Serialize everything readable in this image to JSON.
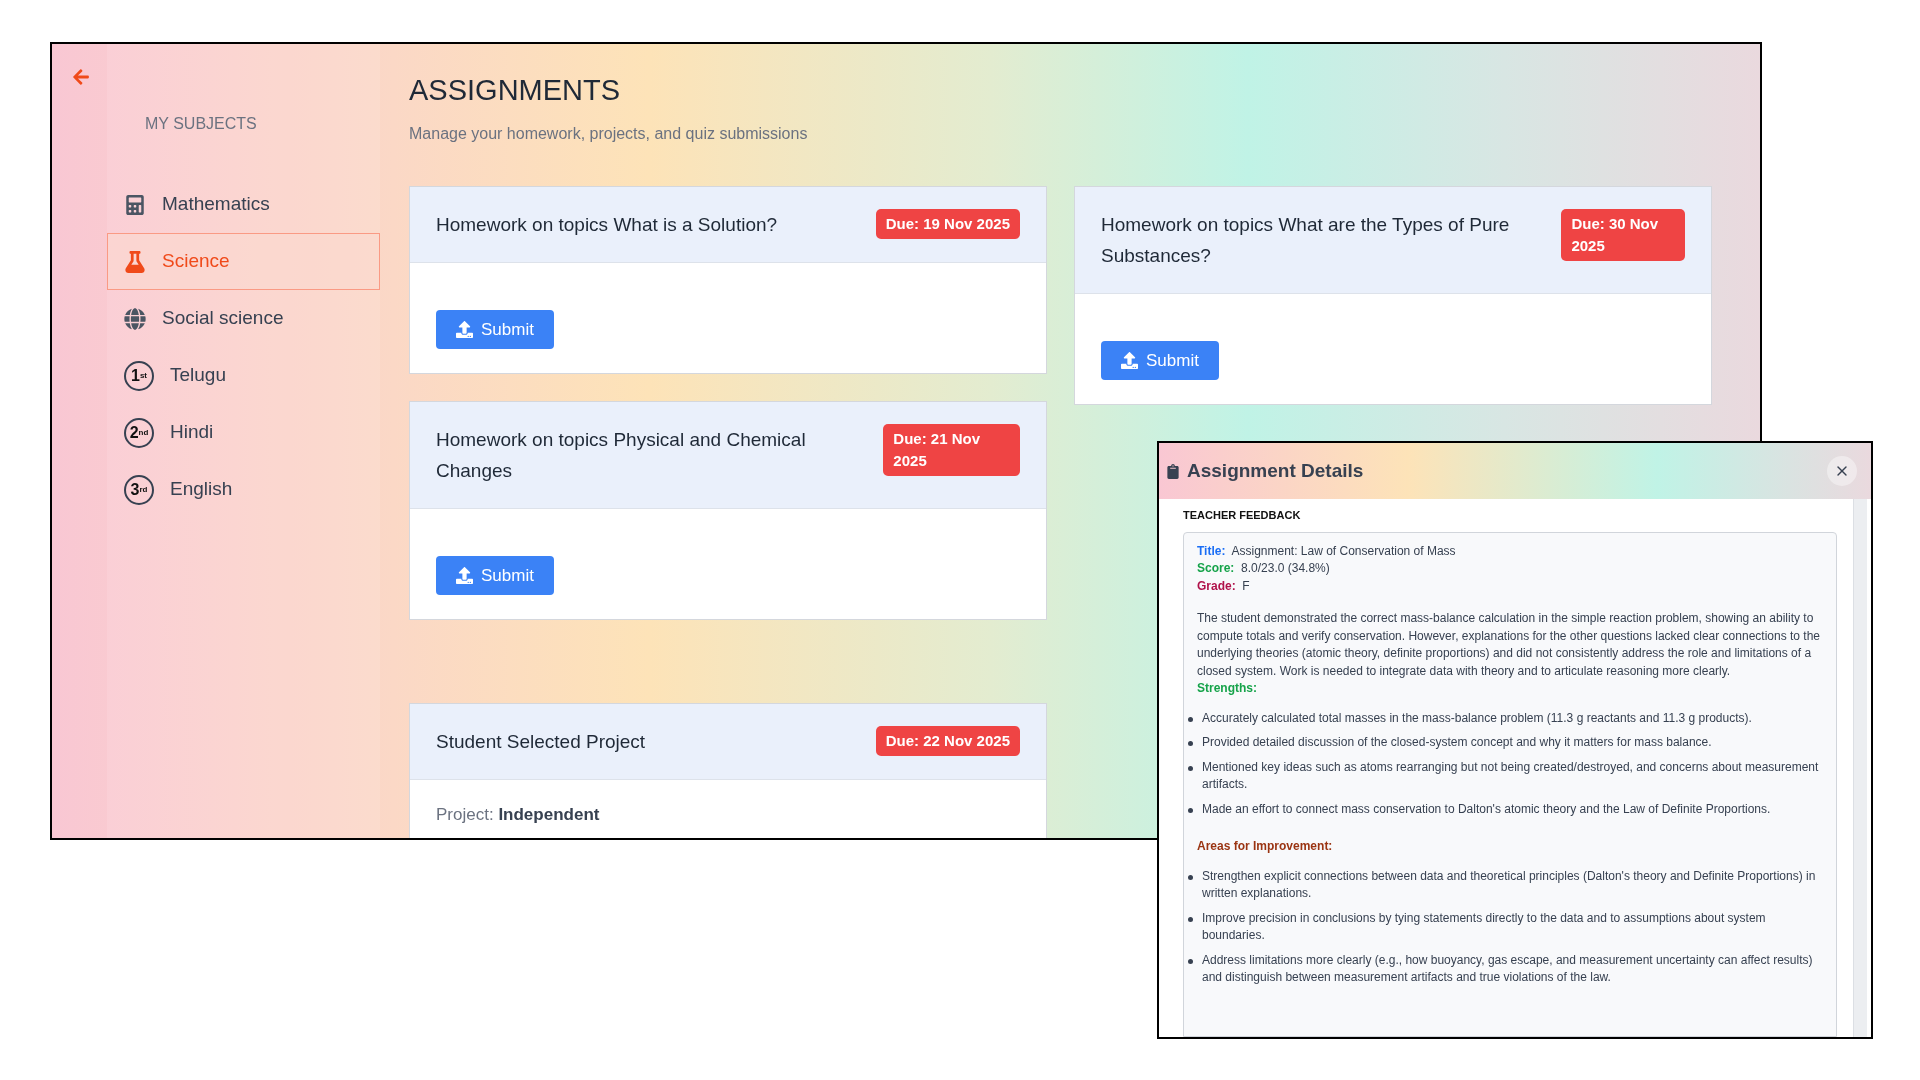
{
  "sidebar": {
    "heading": "MY SUBJECTS",
    "items": [
      {
        "kind": "calculator",
        "label": "Mathematics",
        "selected": false
      },
      {
        "kind": "flask",
        "label": "Science",
        "selected": true
      },
      {
        "kind": "globe",
        "label": "Social science",
        "selected": false
      },
      {
        "kind": "ordinal",
        "number": "1",
        "suffix": "st",
        "label": "Telugu",
        "selected": false
      },
      {
        "kind": "ordinal",
        "number": "2",
        "suffix": "nd",
        "label": "Hindi",
        "selected": false
      },
      {
        "kind": "ordinal",
        "number": "3",
        "suffix": "rd",
        "label": "English",
        "selected": false
      }
    ]
  },
  "main": {
    "title": "ASSIGNMENTS",
    "subtitle": "Manage your homework, projects, and quiz submissions",
    "columns": [
      [
        {
          "kind": "submit",
          "title": "Homework on topics What is a Solution?",
          "due": "Due: 19 Nov 2025",
          "button": "Submit"
        },
        {
          "kind": "submit",
          "title": "Homework on topics Physical and Chemical Changes",
          "due": "Due: 21 Nov 2025",
          "button": "Submit"
        },
        {
          "kind": "project",
          "title": "Student Selected Project",
          "due": "Due: 22 Nov 2025",
          "project_label": "Project:",
          "project_value": "Independent"
        }
      ],
      [
        {
          "kind": "submit",
          "title": "Homework on topics What are the Types of Pure Substances?",
          "due": "Due: 30 Nov 2025",
          "button": "Submit"
        }
      ]
    ]
  },
  "modal": {
    "title": "Assignment Details",
    "section_label": "TEACHER FEEDBACK",
    "fields": [
      {
        "label": "Title:",
        "value": "Assignment: Law of Conservation of Mass",
        "color": "#1a6ef5"
      },
      {
        "label": "Score:",
        "value": "8.0/23.0 (34.8%)",
        "color": "#16a34a"
      },
      {
        "label": "Grade:",
        "value": "F",
        "color": "#b0124a"
      }
    ],
    "summary": "The student demonstrated the correct mass-balance calculation in the simple reaction problem, showing an ability to compute totals and verify conservation. However, explanations for the other questions lacked clear connections to the underlying theories (atomic theory, definite proportions) and did not consistently address the role and limitations of a closed system. Work is needed to integrate data with theory and to articulate reasoning more clearly.",
    "sections": [
      {
        "heading": "Strengths:",
        "color": "#16a34a",
        "items": [
          "Accurately calculated total masses in the mass-balance problem (11.3 g reactants and 11.3 g products).",
          "Provided detailed discussion of the closed-system concept and why it matters for mass balance.",
          "Mentioned key ideas such as atoms rearranging but not being created/destroyed, and concerns about measurement artifacts.",
          "Made an effort to connect mass conservation to Dalton's atomic theory and the Law of Definite Proportions."
        ]
      },
      {
        "heading": "Areas for Improvement:",
        "color": "#9a3412",
        "items": [
          "Strengthen explicit connections between data and theoretical principles (Dalton's theory and Definite Proportions) in written explanations.",
          "Improve precision in conclusions by tying statements directly to the data and to assumptions about system boundaries.",
          "Address limitations more clearly (e.g., how buoyancy, gas escape, and measurement uncertainty can affect results) and distinguish between measurement artifacts and true violations of the law."
        ]
      }
    ]
  }
}
